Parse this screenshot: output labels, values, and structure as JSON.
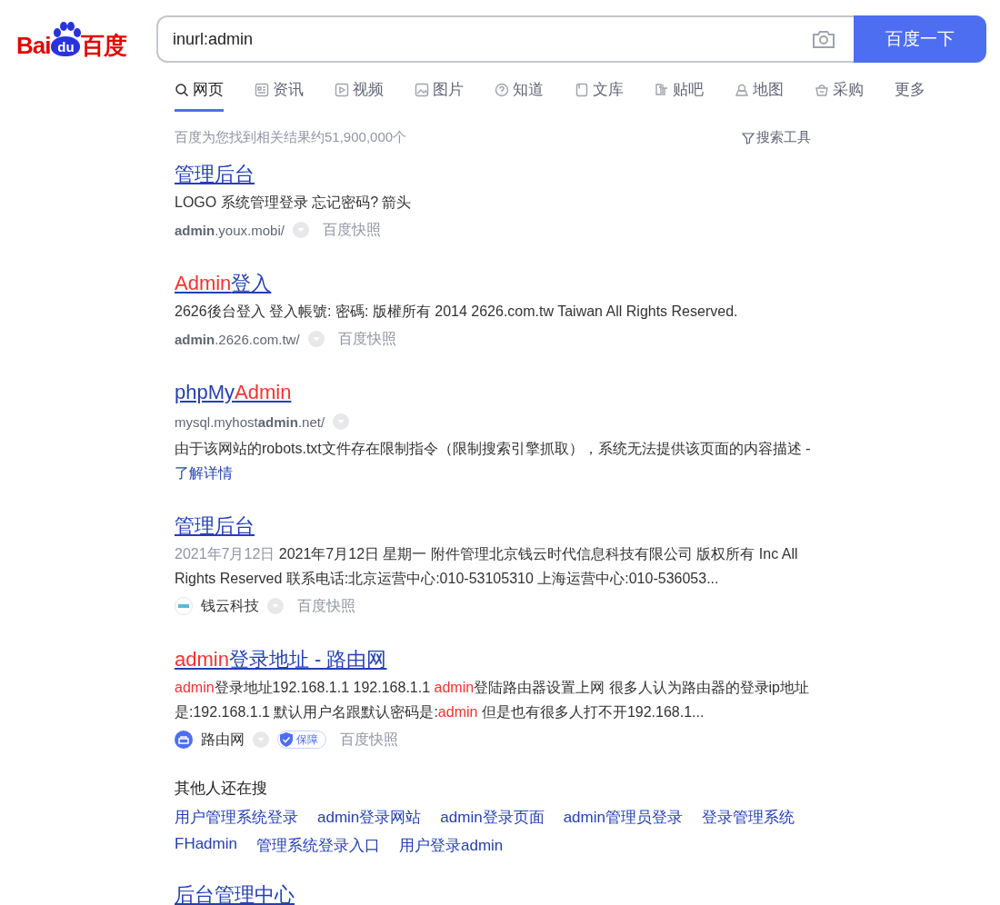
{
  "logo": {
    "parts": [
      "Bai",
      "du",
      "百度"
    ]
  },
  "search": {
    "value": "inurl:admin",
    "button": "百度一下"
  },
  "tabs": [
    {
      "label": "网页",
      "selected": true
    },
    {
      "label": "资讯",
      "selected": false
    },
    {
      "label": "视频",
      "selected": false
    },
    {
      "label": "图片",
      "selected": false
    },
    {
      "label": "知道",
      "selected": false
    },
    {
      "label": "文库",
      "selected": false
    },
    {
      "label": "贴吧",
      "selected": false
    },
    {
      "label": "地图",
      "selected": false
    },
    {
      "label": "采购",
      "selected": false
    },
    {
      "label": "更多",
      "selected": false
    }
  ],
  "result_count": "百度为您找到相关结果约51,900,000个",
  "tools": "搜索工具",
  "results": [
    {
      "kind": "desc_first",
      "title": [
        {
          "text": "管理后台",
          "hl": false
        }
      ],
      "desc": [
        {
          "text": "LOGO 系统管理登录 忘记密码? 箭头",
          "hl": false
        }
      ],
      "url": "**admin**.youx.mobi/",
      "snapshot": "百度快照"
    },
    {
      "kind": "desc_first",
      "title": [
        {
          "text": "Admin",
          "hl": true
        },
        {
          "text": "登入",
          "hl": false
        }
      ],
      "desc": [
        {
          "text": "2626後台登入 登入帳號: 密碼: 版權所有 2014 2626.com.tw Taiwan All Rights Reserved.",
          "hl": false
        }
      ],
      "url": "**admin**.2626.com.tw/",
      "snapshot": "百度快照"
    },
    {
      "kind": "url_first",
      "title": [
        {
          "text": "phpMy",
          "hl": false
        },
        {
          "text": "Admin",
          "hl": true
        }
      ],
      "url": "mysql.myhost**admin**.net/",
      "desc": [
        {
          "text": "由于该网站的robots.txt文件存在限制指令（限制搜索引擎抓取），系统无法提供该页面的内容描述 - ",
          "hl": false
        }
      ],
      "more": "了解详情"
    },
    {
      "kind": "desc_first",
      "title": [
        {
          "text": "管理后台",
          "hl": false
        }
      ],
      "date": "2021年7月12日",
      "desc": [
        {
          "text": "2021年7月12日 星期一 附件管理北京钱云时代信息科技有限公司 版权所有 Inc All Rights Reserved 联系电话:北京运营中心:010-53105310 上海运营中心:010-536053...",
          "hl": false
        }
      ],
      "source": "钱云科技",
      "snapshot": "百度快照"
    },
    {
      "kind": "desc_first",
      "title": [
        {
          "text": "admin",
          "hl": true
        },
        {
          "text": "登录地址 - 路由网",
          "hl": false
        }
      ],
      "desc": [
        {
          "text": "admin",
          "hl": true
        },
        {
          "text": "登录地址192.168.1.1 192.168.1.1 ",
          "hl": false
        },
        {
          "text": "admin",
          "hl": true
        },
        {
          "text": "登陆路由器设置上网 很多人认为路由器的登录ip地址是:192.168.1.1 默认用户名跟默认密码是:",
          "hl": false
        },
        {
          "text": "admin",
          "hl": true
        },
        {
          "text": " 但是也有很多人打不开192.168.1...",
          "hl": false
        }
      ],
      "source": "路由网",
      "badge": "保障",
      "snapshot": "百度快照"
    }
  ],
  "related": {
    "title": "其他人还在搜",
    "items": [
      "用户管理系统登录",
      "admin登录网站",
      "admin登录页面",
      "admin管理员登录",
      "登录管理系统",
      "FHadmin",
      "管理系统登录入口",
      "用户登录admin"
    ]
  },
  "last_result": {
    "title": "后台管理中心"
  }
}
